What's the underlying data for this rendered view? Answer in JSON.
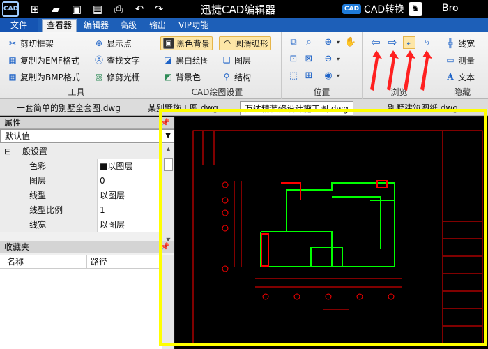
{
  "titlebar": {
    "logo": "CAD",
    "title": "迅捷CAD编辑器",
    "cad_convert": "CAD转换",
    "cad_convert_badge": "CAD",
    "user": "Bro"
  },
  "menu": {
    "file": "文件",
    "tabs": [
      "查看器",
      "编辑器",
      "高级",
      "输出",
      "VIP功能"
    ]
  },
  "ribbon": {
    "tools": {
      "label": "工具",
      "buttons": [
        "剪切框架",
        "复制为EMF格式",
        "复制为BMP格式",
        "显示点",
        "查找文字",
        "修剪光栅"
      ]
    },
    "cad_settings": {
      "label": "CAD绘图设置",
      "buttons": [
        "黑色背景",
        "黑白绘图",
        "背景色",
        "圆滑弧形",
        "图层",
        "结构"
      ]
    },
    "position": {
      "label": "位置"
    },
    "browse": {
      "label": "浏览"
    },
    "hide": {
      "label": "隐藏",
      "buttons": [
        "线宽",
        "测量",
        "文本"
      ]
    }
  },
  "doctabs": [
    "一套简单的别墅全套图.dwg",
    "某别墅施工图.dwg",
    "万达精装修设计施工图.dwg",
    "别墅建筑图纸.dwg"
  ],
  "properties": {
    "title": "属性",
    "dropdown": "默认值",
    "group": "一般设置",
    "rows": [
      {
        "key": "色彩",
        "value": "■以图层"
      },
      {
        "key": "图层",
        "value": "0"
      },
      {
        "key": "线型",
        "value": "以图层"
      },
      {
        "key": "线型比例",
        "value": "1"
      },
      {
        "key": "线宽",
        "value": "以图层"
      }
    ]
  },
  "favorites": {
    "title": "收藏夹",
    "col_name": "名称",
    "col_path": "路径"
  },
  "colors": {
    "titlebar": "#000000",
    "menubar": "#1d5fb8",
    "highlight_frame": "#ffff00",
    "annotation_arrow": "#ff2020",
    "cad_red": "#ff0000",
    "cad_green": "#00ff00"
  }
}
